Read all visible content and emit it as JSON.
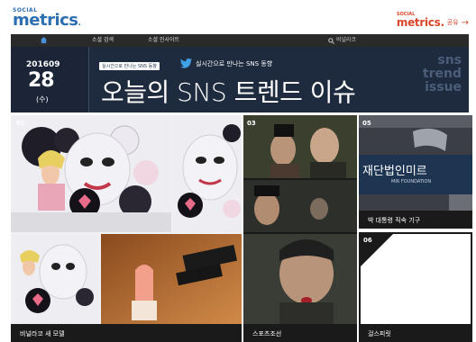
{
  "header": {
    "logo_small": "SOCIAL",
    "logo_big": "metrics",
    "right_logo_small": "SOCIAL",
    "right_logo_big": "metrics",
    "right_logo_tail": "공유"
  },
  "nav": {
    "items": [
      "소셜 검색",
      "소셜 인사이트"
    ],
    "search_value": "비널라코"
  },
  "banner": {
    "year_month": "201609",
    "day": "28",
    "weekday": "(수)",
    "tag": "실시간으로 만나는 SNS 동향",
    "subline": "실시간으로 만나는 SNS 동향",
    "headline": "오늘의 SNS 트렌드 이슈",
    "watermark": [
      "sns",
      "trend",
      "issue"
    ]
  },
  "tiles": [
    {
      "num": "01",
      "label": "비널라코 새 모델"
    },
    {
      "num": "03",
      "label": "스포츠조선"
    },
    {
      "num": "05",
      "label": "박 대통령 직속 기구"
    },
    {
      "num": "06",
      "label": "걸스피릿"
    }
  ],
  "sign": {
    "line1": "재단법인미르",
    "line2": "MIR FOUNDATION"
  },
  "icons": [
    "home-icon",
    "search-icon",
    "twitter-icon",
    "arrow-right-icon"
  ],
  "colors": {
    "brand_blue": "#2d6fb3",
    "brand_red": "#d9472b",
    "banner_bg": "#1e2b3f",
    "nav_bg": "#2a2a2a"
  }
}
